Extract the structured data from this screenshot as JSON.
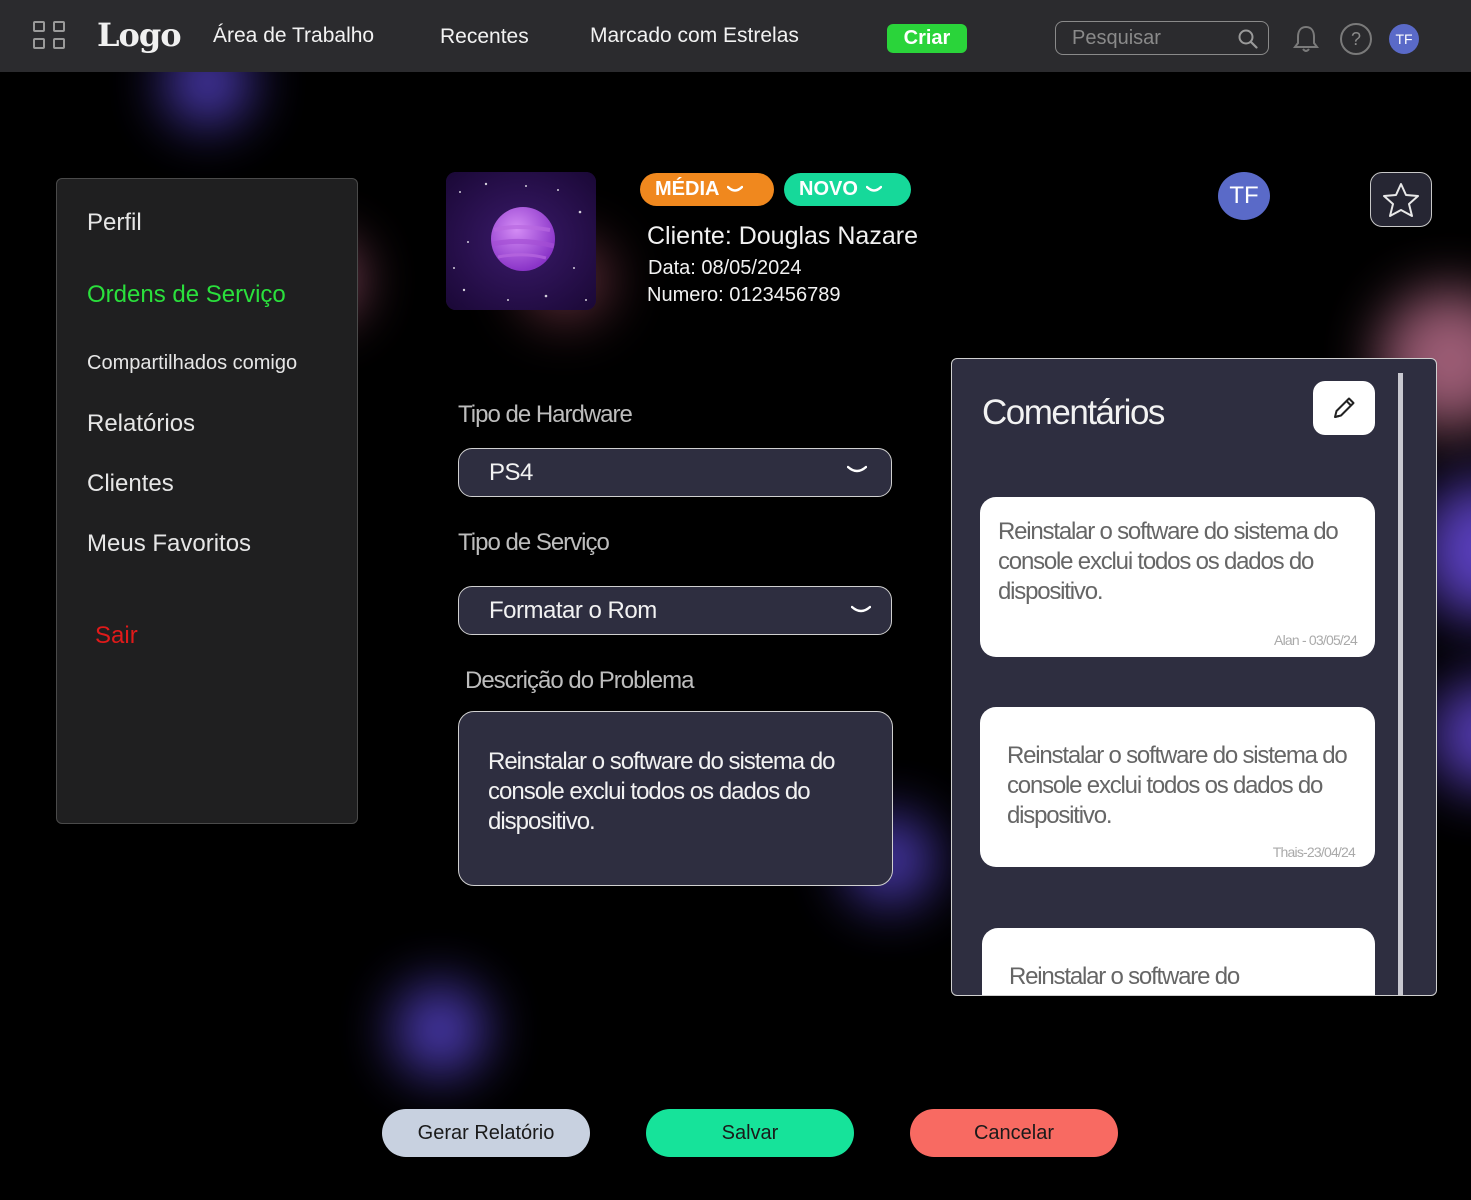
{
  "topbar": {
    "logo": "Logo",
    "nav": [
      "Área de Trabalho",
      "Recentes",
      "Marcado com Estrelas"
    ],
    "create_label": "Criar",
    "search_placeholder": "Pesquisar",
    "help_glyph": "?",
    "user_initials": "TF"
  },
  "sidebar": {
    "items": [
      {
        "label": "Perfil"
      },
      {
        "label": "Ordens de Serviço"
      },
      {
        "label": "Compartilhados comigo"
      },
      {
        "label": "Relatórios"
      },
      {
        "label": "Clientes"
      },
      {
        "label": "Meus Favoritos"
      },
      {
        "label": "Sair"
      }
    ]
  },
  "order": {
    "priority_badge": "MÉDIA",
    "status_badge": "NOVO",
    "client": "Cliente: Douglas Nazare",
    "date": "Data: 08/05/2024",
    "number": "Numero: 0123456789",
    "assignee_initials": "TF"
  },
  "form": {
    "hardware_label": "Tipo de Hardware",
    "hardware_value": "PS4",
    "service_label": "Tipo de Serviço",
    "service_value": "Formatar o Rom",
    "description_label": "Descrição do Problema",
    "description_value": "Reinstalar o software do sistema do console exclui todos os dados do dispositivo."
  },
  "comments": {
    "title": "Comentários",
    "items": [
      {
        "text": "Reinstalar o software do sistema do console exclui todos os dados do dispositivo.",
        "signature": "Alan - 03/05/24"
      },
      {
        "text": "Reinstalar o software do sistema do console exclui todos os dados do dispositivo.",
        "signature": "Thais-23/04/24"
      },
      {
        "text": "Reinstalar o software do",
        "signature": ""
      }
    ]
  },
  "actions": {
    "report_label": "Gerar Relatório",
    "save_label": "Salvar",
    "cancel_label": "Cancelar"
  },
  "colors": {
    "accent_green": "#2ae03c",
    "badge_orange": "#f0881e",
    "badge_teal": "#16d99a",
    "danger": "#e01a1a",
    "save": "#16e39a",
    "cancel": "#f86a62"
  },
  "icons": [
    "apps-grid-icon",
    "search-icon",
    "bell-icon",
    "help-icon",
    "chevron-down-icon",
    "star-icon",
    "pencil-icon",
    "planet-image"
  ]
}
